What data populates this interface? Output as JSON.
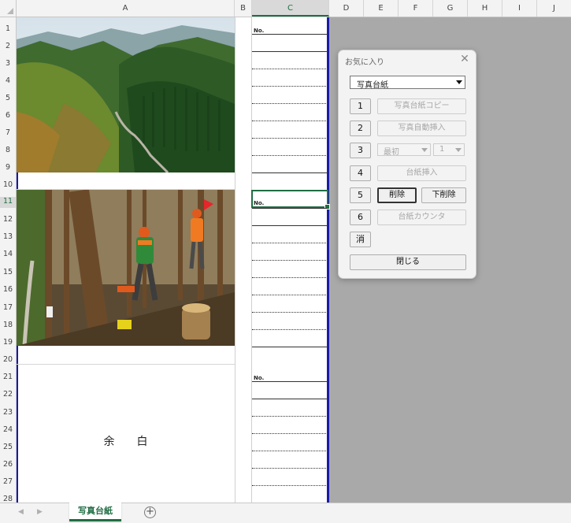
{
  "columns": [
    "A",
    "B",
    "C",
    "D",
    "E",
    "F",
    "G",
    "H",
    "I",
    "J"
  ],
  "rows": [
    "1",
    "2",
    "3",
    "4",
    "5",
    "6",
    "7",
    "8",
    "9",
    "10",
    "11",
    "12",
    "13",
    "14",
    "15",
    "16",
    "17",
    "18",
    "19",
    "20",
    "21",
    "22",
    "23",
    "24",
    "25",
    "26",
    "27",
    "28"
  ],
  "cells": {
    "no_label": "No.",
    "margin_text": "余白"
  },
  "photos": [
    {
      "icon": "forest-valley-photo"
    },
    {
      "icon": "forestry-workers-photo"
    }
  ],
  "dialog": {
    "title": "お気に入り",
    "close_icon": "close-icon",
    "selected_template": "写真台紙",
    "buttons": [
      {
        "num": "1",
        "label": "写真台紙コピー"
      },
      {
        "num": "2",
        "label": "写真自動挿入"
      },
      {
        "num": "3",
        "select_a": "最初",
        "select_b": "1"
      },
      {
        "num": "4",
        "label": "台紙挿入"
      },
      {
        "num": "5",
        "label": "削除",
        "label2": "下削除"
      },
      {
        "num": "6",
        "label": "台紙カウンタ"
      },
      {
        "num": "消"
      }
    ],
    "close_label": "閉じる"
  },
  "sheet_tabs": {
    "active": "写真台紙",
    "add_icon": "plus-circle-icon"
  },
  "colors": {
    "accent": "#1f6e43",
    "print_area": "#1a1aa8"
  }
}
